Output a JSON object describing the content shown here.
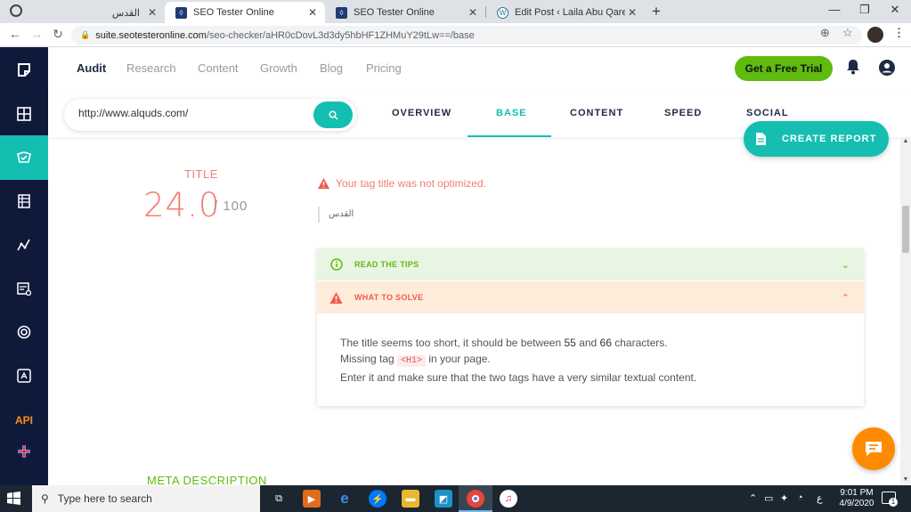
{
  "browser": {
    "tabs": [
      {
        "title": "القدس"
      },
      {
        "title": "SEO Tester Online"
      },
      {
        "title": "SEO Tester Online"
      },
      {
        "title": "Edit Post ‹ Laila Abu Qare — Wo"
      }
    ],
    "new_tab": "+",
    "url_host": "suite.seotesteronline.com",
    "url_path": "/seo-checker/aHR0cDovL3d3dy5hbHF1ZHMuY29tLw==/base"
  },
  "sidebar": {
    "api_label": "API"
  },
  "topnav": {
    "links": [
      "Audit",
      "Research",
      "Content",
      "Growth",
      "Blog",
      "Pricing"
    ],
    "cta": "Get a Free Trial"
  },
  "subbar": {
    "url_value": "http://www.alquds.com/",
    "tabs": [
      "OVERVIEW",
      "BASE",
      "CONTENT",
      "SPEED",
      "SOCIAL"
    ],
    "active_tab": "BASE",
    "create_report": "CREATE REPORT"
  },
  "title_section": {
    "label": "TITLE",
    "score": "24.0",
    "score_max": "/ 100",
    "warning": "Your tag title was not optimized.",
    "tag_value": "القدس",
    "tips_label": "READ THE TIPS",
    "solve_label": "WHAT TO SOLVE",
    "body_line1_pre": "The title seems too short, it should be between ",
    "body_min": "55",
    "body_and": " and ",
    "body_max": "66",
    "body_line1_post": " characters.",
    "body_line2_pre": "Missing tag ",
    "body_tag": "<H1>",
    "body_line2_post": " in your page.",
    "body_line3": "Enter it and make sure that the two tags have a very similar textual content."
  },
  "meta_section": {
    "label": "META DESCRIPTION"
  },
  "taskbar": {
    "search_placeholder": "Type here to search",
    "time": "9:01 PM",
    "date": "4/9/2020",
    "lang": "ع",
    "notif_count": "1"
  },
  "colors": {
    "sidebar_bg": "#0f1a3b",
    "accent_teal": "#14bfb2",
    "cta_green": "#5fbb0e",
    "score_red": "#f47c72",
    "chat_orange": "#ff8a00"
  }
}
